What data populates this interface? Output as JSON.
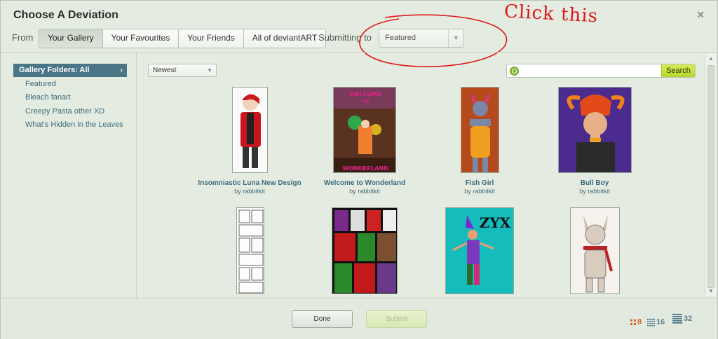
{
  "dialog": {
    "title": "Choose A Deviation",
    "close_glyph": "✕"
  },
  "source": {
    "from_label": "From",
    "tabs": [
      {
        "label": "Your Gallery",
        "active": true
      },
      {
        "label": "Your Favourites",
        "active": false
      },
      {
        "label": "Your Friends",
        "active": false
      },
      {
        "label": "All of deviantART",
        "active": false
      }
    ],
    "submitting_label": "Submitting to",
    "submitting_value": "Featured"
  },
  "annotation": {
    "text": "Click this",
    "color": "#e01818"
  },
  "sidebar": {
    "header": "Gallery Folders: All",
    "folders": [
      "Featured",
      "Bleach fanart",
      "Creepy Pasta other XD",
      "What's Hidden in the Leaves"
    ]
  },
  "toolbar": {
    "sort_value": "Newest",
    "search_placeholder": "",
    "search_button": "Search"
  },
  "deviations": [
    {
      "title": "Insomniastic Luna New Design",
      "by": "by",
      "author": "rabbitkit"
    },
    {
      "title": "Welcome to Wonderland",
      "by": "by",
      "author": "rabbitkit",
      "art_text": "WELCOME TO WONDERLAND"
    },
    {
      "title": "Fish Girl",
      "by": "by",
      "author": "rabbitkit"
    },
    {
      "title": "Bull Boy",
      "by": "by",
      "author": "rabbitkit"
    },
    {
      "title": "",
      "author": ""
    },
    {
      "title": "",
      "author": ""
    },
    {
      "title": "",
      "author": "",
      "art_text": "ZYX"
    },
    {
      "title": "",
      "author": ""
    }
  ],
  "footer": {
    "done_label": "Done",
    "submit_label": "Submit",
    "sizes": [
      {
        "label": "8",
        "color": "#d9622b"
      },
      {
        "label": "16",
        "color": "#5b7f90"
      },
      {
        "label": "32",
        "color": "#5b7f90"
      }
    ]
  },
  "colors": {
    "accent_blue": "#4a7586",
    "link_blue": "#3d6b7a",
    "search_green": "#c4df3e",
    "background": "#e4ebe1"
  }
}
